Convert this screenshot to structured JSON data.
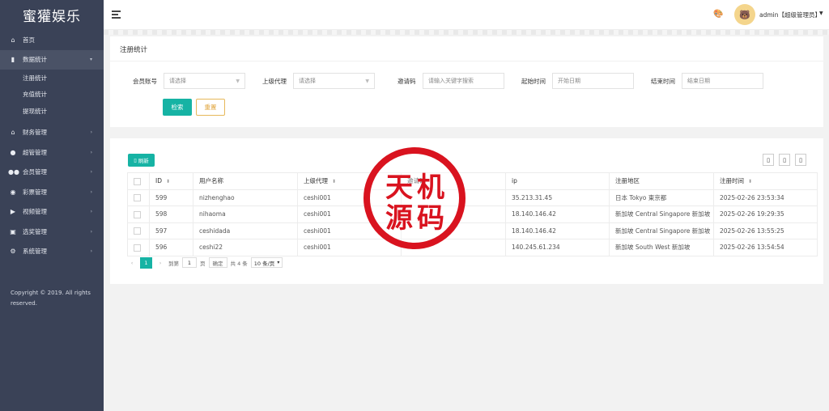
{
  "app": {
    "title": "蜜獾娱乐"
  },
  "sidebar": {
    "items": [
      {
        "label": "首页",
        "icon": "home-icon"
      },
      {
        "label": "数据统计",
        "icon": "bar-chart-icon",
        "expanded": true,
        "children": [
          "注册统计",
          "充值统计",
          "提现统计"
        ]
      },
      {
        "label": "财务管理",
        "icon": "bank-icon"
      },
      {
        "label": "超管管理",
        "icon": "user-icon"
      },
      {
        "label": "会员管理",
        "icon": "users-icon"
      },
      {
        "label": "彩票管理",
        "icon": "gamepad-icon"
      },
      {
        "label": "视频管理",
        "icon": "video-icon"
      },
      {
        "label": "选奖管理",
        "icon": "ticket-icon"
      },
      {
        "label": "系统管理",
        "icon": "gear-icon"
      }
    ],
    "copyright": "Copyright © 2019. All rights reserved."
  },
  "header": {
    "user": "admin【超级管理员】"
  },
  "filter": {
    "title": "注册统计",
    "member_label": "会员账号",
    "member_placeholder": "请选择",
    "agent_label": "上级代理",
    "agent_placeholder": "请选择",
    "invite_label": "邀请码",
    "invite_placeholder": "请输入关键字搜索",
    "start_label": "起始时间",
    "start_placeholder": "开始日期",
    "end_label": "结束时间",
    "end_placeholder": "结束日期",
    "search_button": "检索",
    "reset_button": "重置"
  },
  "table": {
    "refresh_button": "刷新",
    "columns": [
      "ID",
      "用户名称",
      "上级代理",
      "邀请码",
      "ip",
      "注册地区",
      "注册时间"
    ],
    "rows": [
      {
        "id": "599",
        "username": "nizhenghao",
        "agent": "ceshi001",
        "invite": "",
        "ip": "35.213.31.45",
        "region": "日本 Tokyo 東京都",
        "time": "2025-02-26 23:53:34"
      },
      {
        "id": "598",
        "username": "nihaoma",
        "agent": "ceshi001",
        "invite": "",
        "ip": "18.140.146.42",
        "region": "新加坡 Central Singapore 新加坡",
        "time": "2025-02-26 19:29:35"
      },
      {
        "id": "597",
        "username": "ceshidada",
        "agent": "ceshi001",
        "invite": "",
        "ip": "18.140.146.42",
        "region": "新加坡 Central Singapore 新加坡",
        "time": "2025-02-26 13:55:25"
      },
      {
        "id": "596",
        "username": "ceshi22",
        "agent": "ceshi001",
        "invite": "",
        "ip": "140.245.61.234",
        "region": "新加坡 South West 新加坡",
        "time": "2025-02-26 13:54:54"
      }
    ]
  },
  "pager": {
    "current": "1",
    "goto_label": "到第",
    "goto_value": "1",
    "page_unit": "页",
    "confirm": "确定",
    "total": "共 4 条",
    "page_size": "10 条/页"
  },
  "watermark": {
    "text": "天机源码"
  },
  "colors": {
    "sidebar": "#3a4257",
    "accent": "#16b3a4",
    "stamp": "#d9131f"
  }
}
